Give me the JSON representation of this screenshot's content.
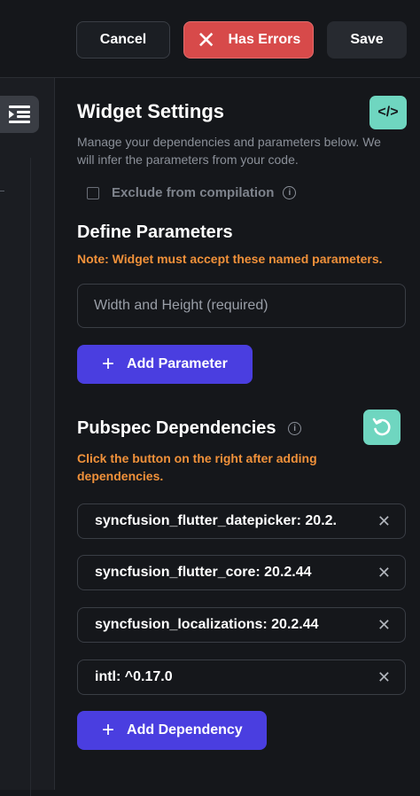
{
  "toolbar": {
    "cancel_label": "Cancel",
    "errors_label": "Has Errors",
    "errors_icon": "✕",
    "save_label": "Save"
  },
  "settings": {
    "title": "Widget Settings",
    "description": "Manage your dependencies and parameters below. We will infer the parameters from your code.",
    "exclude_label": "Exclude from compilation",
    "code_icon": "</>"
  },
  "parameters": {
    "heading": "Define Parameters",
    "note": "Note: Widget must accept these named parameters.",
    "input_placeholder": "Width and Height (required)",
    "add_label": "Add Parameter"
  },
  "dependencies": {
    "heading": "Pubspec Dependencies",
    "note": "Click the button on the right after adding dependencies.",
    "items": [
      {
        "label": "syncfusion_flutter_datepicker: 20.2."
      },
      {
        "label": "syncfusion_flutter_core: 20.2.44"
      },
      {
        "label": "syncfusion_localizations: 20.2.44"
      },
      {
        "label": "intl: ^0.17.0"
      }
    ],
    "add_label": "Add Dependency"
  },
  "colors": {
    "accent": "#4a3ee0",
    "error": "#d74a4a",
    "teal": "#6fd6c0",
    "warning": "#f0913a"
  }
}
